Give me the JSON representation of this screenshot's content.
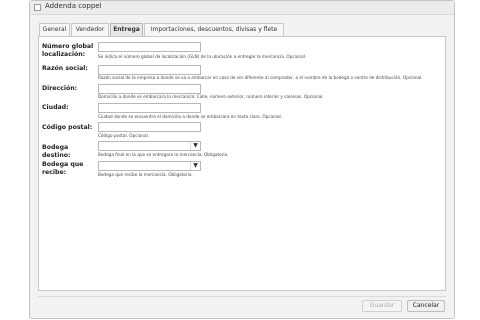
{
  "window": {
    "title": "Addenda coppel"
  },
  "tabs": [
    {
      "label": "General"
    },
    {
      "label": "Vendedor"
    },
    {
      "label": "Entrega"
    },
    {
      "label": "Importaciones, descuentos, divisas y flete"
    }
  ],
  "active_tab": "Entrega",
  "form": {
    "gln": {
      "label": "Número global localización:",
      "value": "",
      "hint": "Se indica el número global de localización (GLN) de la ubicación a entregar la mercancía. Opcional."
    },
    "razon_social": {
      "label": "Razón social:",
      "value": "",
      "hint": "Razón social de la empresa a donde se va a embarcar en caso de ser diferente al comprador, o el nombre de la bodega o centro de distribución. Opcional."
    },
    "direccion": {
      "label": "Dirección:",
      "value": "",
      "hint": "Domicilio a donde se embarcara la mercancía: Calle, número exterior, número interior y colonias. Opcional."
    },
    "ciudad": {
      "label": "Ciudad:",
      "value": "",
      "hint": "Ciudad donde se encuentra el domicilio a donde se embarcara en texto claro. Opcional."
    },
    "codigo_postal": {
      "label": "Código postal:",
      "value": "",
      "hint": "Código postal. Opcional."
    },
    "bodega_destino": {
      "label": "Bodega destino:",
      "value": "",
      "hint": "Bodega final en la que se entregara la mercancía. Obligatorio."
    },
    "bodega_recibe": {
      "label": "Bodega que recibe:",
      "value": "",
      "hint": "Bodega que recibe la mercancía. Obligatorio."
    }
  },
  "buttons": {
    "save_label": "Guardar",
    "cancel_label": "Cancelar"
  }
}
